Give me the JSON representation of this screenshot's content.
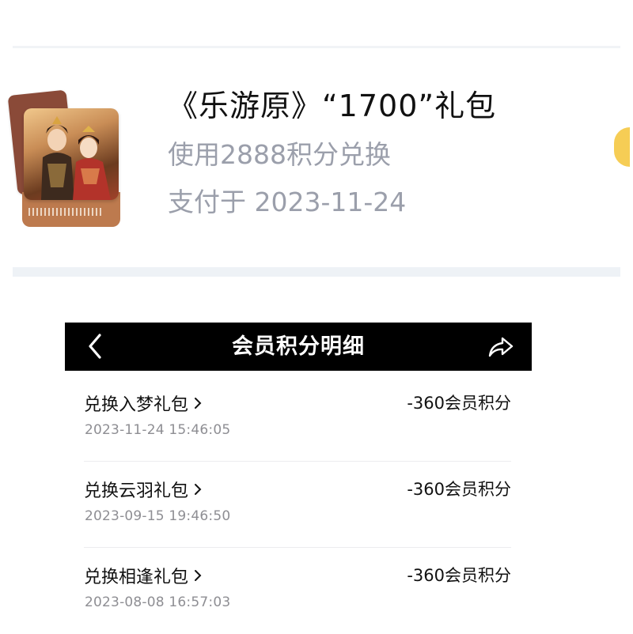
{
  "order": {
    "title": "《乐游原》“1700”礼包",
    "subtitle": "使用2888积分兑换",
    "paid_date": "支付于 2023-11-24"
  },
  "navbar": {
    "title": "会员积分明细",
    "back_icon": "chevron-left-icon",
    "share_icon": "share-icon"
  },
  "records": [
    {
      "title": "兑换入梦礼包",
      "points": "-360会员积分",
      "time": "2023-11-24 15:46:05"
    },
    {
      "title": "兑换云羽礼包",
      "points": "-360会员积分",
      "time": "2023-09-15 19:46:50"
    },
    {
      "title": "兑换相逢礼包",
      "points": "-360会员积分",
      "time": "2023-08-08 16:57:03"
    }
  ],
  "colors": {
    "navbar_bg": "#000000",
    "secondary_text": "#9b9fab",
    "timestamp_text": "#8e8e93",
    "coin_accent": "#f6cd55"
  }
}
